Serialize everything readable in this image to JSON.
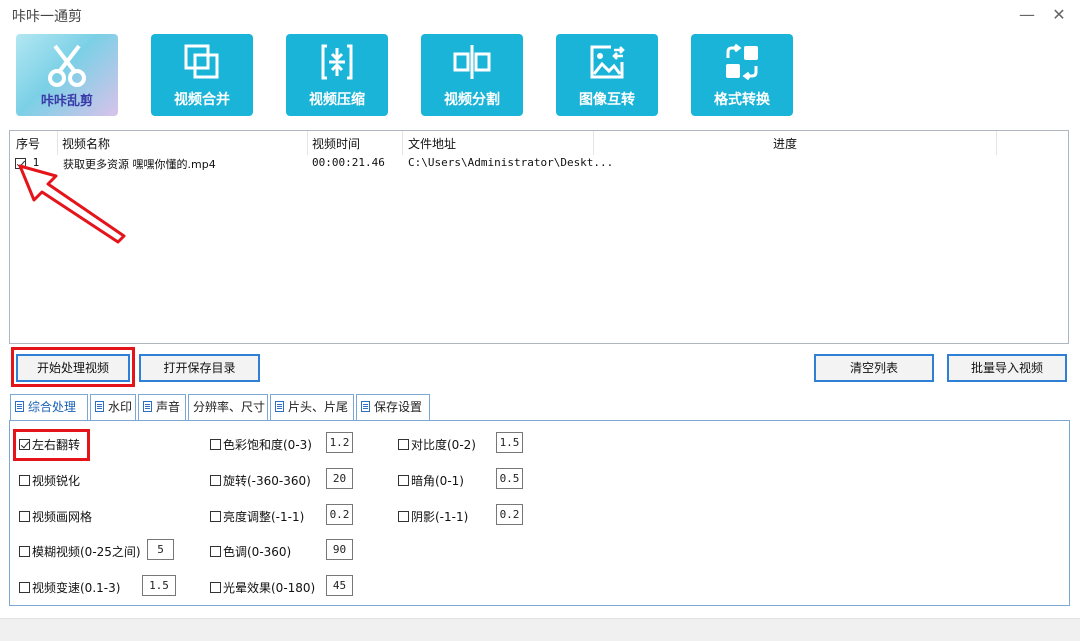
{
  "window": {
    "title": "咔咔一通剪",
    "minimize_glyph": "—",
    "close_glyph": "✕"
  },
  "toolbar": {
    "logo_label": "咔咔乱剪",
    "tiles": [
      {
        "label": "视频合并",
        "icon": "merge-icon"
      },
      {
        "label": "视频压缩",
        "icon": "compress-icon"
      },
      {
        "label": "视频分割",
        "icon": "split-icon"
      },
      {
        "label": "图像互转",
        "icon": "image-convert-icon"
      },
      {
        "label": "格式转换",
        "icon": "format-convert-icon"
      }
    ]
  },
  "list": {
    "columns": [
      "序号",
      "视频名称",
      "视频时间",
      "文件地址",
      "进度"
    ],
    "rows": [
      {
        "checked": true,
        "index": "1",
        "name": "获取更多资源 嘿嘿你懂的.mp4",
        "duration": "00:00:21.46",
        "path": "C:\\Users\\Administrator\\Deskt...",
        "progress": ""
      }
    ]
  },
  "buttons": {
    "start": "开始处理视频",
    "open_dir": "打开保存目录",
    "clear": "清空列表",
    "batch_import": "批量导入视频"
  },
  "tabs": [
    "综合处理",
    "水印",
    "声音",
    "分辨率、尺寸",
    "片头、片尾",
    "保存设置"
  ],
  "active_tab": "综合处理",
  "options": {
    "col1": [
      {
        "label": "左右翻转",
        "checked": true
      },
      {
        "label": "视频锐化",
        "checked": false
      },
      {
        "label": "视频画网格",
        "checked": false
      },
      {
        "label": "模糊视频(0-25之间)",
        "checked": false,
        "value": "5"
      },
      {
        "label": "视频变速(0.1-3)",
        "checked": false,
        "value": "1.5"
      }
    ],
    "col2": [
      {
        "label": "色彩饱和度(0-3)",
        "checked": false,
        "value": "1.2"
      },
      {
        "label": "旋转(-360-360)",
        "checked": false,
        "value": "20"
      },
      {
        "label": "亮度调整(-1-1)",
        "checked": false,
        "value": "0.2"
      },
      {
        "label": "色调(0-360)",
        "checked": false,
        "value": "90"
      },
      {
        "label": "光晕效果(0-180)",
        "checked": false,
        "value": "45"
      }
    ],
    "col3": [
      {
        "label": "对比度(0-2)",
        "checked": false,
        "value": "1.5"
      },
      {
        "label": "暗角(0-1)",
        "checked": false,
        "value": "0.5"
      },
      {
        "label": "阴影(-1-1)",
        "checked": false,
        "value": "0.2"
      }
    ]
  },
  "colors": {
    "tile": "#1ab4d8",
    "highlight": "#e5141b",
    "button_border": "#2f7fd6"
  }
}
